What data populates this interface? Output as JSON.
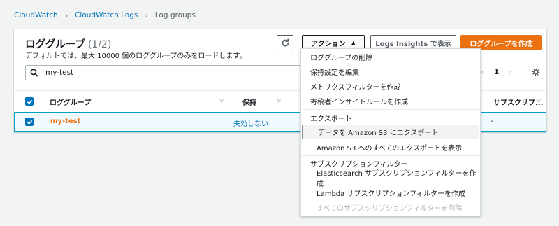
{
  "breadcrumb": {
    "items": [
      "CloudWatch",
      "CloudWatch Logs"
    ],
    "current": "Log groups",
    "separator": "›"
  },
  "panel": {
    "title": "ロググループ",
    "count": "(1/2)",
    "description": "デフォルトでは、最大 10000 個のロググループのみをロードします。"
  },
  "toolbar": {
    "refresh_icon": "refresh-icon",
    "actions_label": "アクション",
    "insights_label": "Logs Insights で表示",
    "create_label": "ロググループを作成"
  },
  "search": {
    "value": "my-test",
    "placeholder": ""
  },
  "pagination": {
    "prev": "‹",
    "page": "1",
    "next": "›"
  },
  "table": {
    "columns": [
      "ロググループ",
      "保持",
      "サブスクリプ..."
    ],
    "rows": [
      {
        "name": "my-test",
        "retention": "失効しない",
        "subscription": "-",
        "selected": true
      }
    ]
  },
  "actions_menu": {
    "items": [
      {
        "label": "ロググループの削除"
      },
      {
        "label": "保持設定を編集"
      },
      {
        "label": "メトリクスフィルターを作成"
      },
      {
        "label": "寄稿者インサイトルールを作成"
      }
    ],
    "export_header": "エクスポート",
    "export_items": [
      {
        "label": "データを Amazon S3 にエクスポート",
        "hover": true
      },
      {
        "label": "Amazon S3 へのすべてのエクスポートを表示"
      }
    ],
    "subscription_header": "サブスクリプションフィルター",
    "subscription_items": [
      {
        "label": "Elasticsearch サブスクリプションフィルターを作成"
      },
      {
        "label": "Lambda サブスクリプションフィルターを作成"
      },
      {
        "label": "すべてのサブスクリプションフィルターを削除",
        "disabled": true
      }
    ]
  },
  "colors": {
    "link": "#0073bb",
    "primary_button": "#ec7211",
    "selected_row_bg": "#f1faff",
    "selected_row_border": "#00a1c9"
  }
}
